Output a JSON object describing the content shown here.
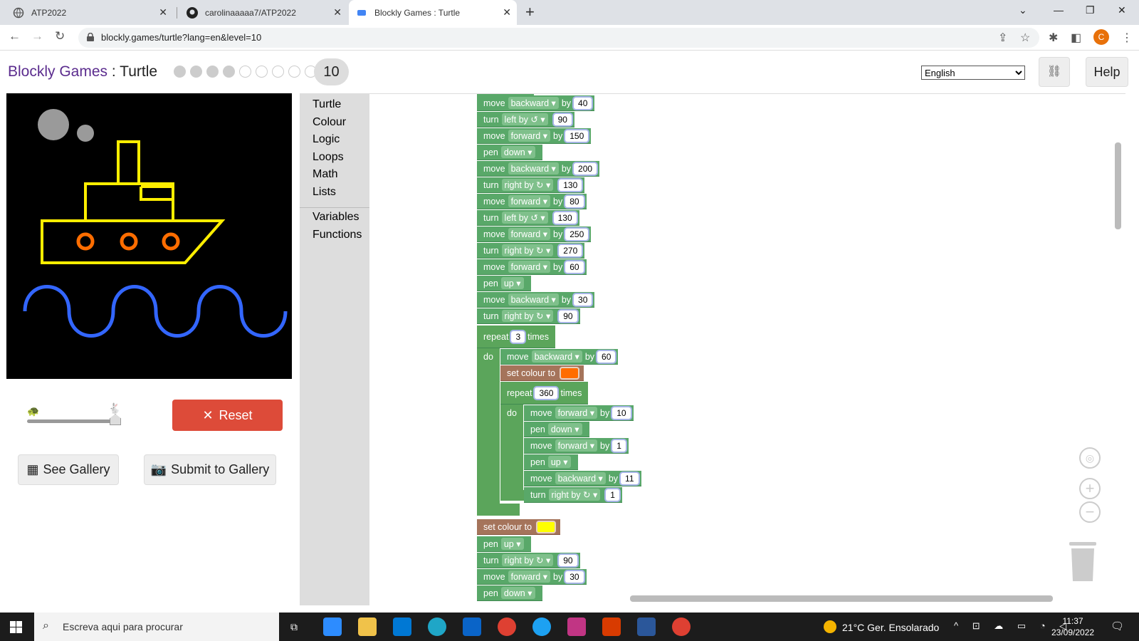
{
  "browser": {
    "tabs": [
      {
        "title": "ATP2022"
      },
      {
        "title": "carolinaaaaa7/ATP2022"
      },
      {
        "title": "Blockly Games : Turtle"
      }
    ],
    "url": "blockly.games/turtle?lang=en&level=10",
    "profile_initial": "C"
  },
  "header": {
    "site_name": "Blockly Games",
    "separator": " : ",
    "game_name": "Turtle",
    "level": "10",
    "levels_completed": 4,
    "levels_total": 9,
    "language": "English",
    "help_label": "Help"
  },
  "controls": {
    "reset_label": "Reset",
    "see_gallery_label": "See Gallery",
    "submit_gallery_label": "Submit to Gallery"
  },
  "toolbox": {
    "categories": [
      "Turtle",
      "Colour",
      "Logic",
      "Loops",
      "Math",
      "Lists"
    ],
    "extra": [
      "Variables",
      "Functions"
    ]
  },
  "blocks": {
    "b1": {
      "kw": "move",
      "dir": "backward",
      "by": "by",
      "val": "40"
    },
    "b2": {
      "kw": "turn",
      "dir": "left by ↺",
      "val": "90"
    },
    "b3": {
      "kw": "move",
      "dir": "forward",
      "by": "by",
      "val": "150"
    },
    "b4": {
      "kw": "pen",
      "dir": "down"
    },
    "b5": {
      "kw": "move",
      "dir": "backward",
      "by": "by",
      "val": "200"
    },
    "b6": {
      "kw": "turn",
      "dir": "right by ↻",
      "val": "130"
    },
    "b7": {
      "kw": "move",
      "dir": "forward",
      "by": "by",
      "val": "80"
    },
    "b8": {
      "kw": "turn",
      "dir": "left by ↺",
      "val": "130"
    },
    "b9": {
      "kw": "move",
      "dir": "forward",
      "by": "by",
      "val": "250"
    },
    "b10": {
      "kw": "turn",
      "dir": "right by ↻",
      "val": "270"
    },
    "b11": {
      "kw": "move",
      "dir": "forward",
      "by": "by",
      "val": "60"
    },
    "b12": {
      "kw": "pen",
      "dir": "up"
    },
    "b13": {
      "kw": "move",
      "dir": "backward",
      "by": "by",
      "val": "30"
    },
    "b14": {
      "kw": "turn",
      "dir": "right by ↻",
      "val": "90"
    },
    "r1": {
      "kw": "repeat",
      "val": "3",
      "times": "times",
      "do": "do"
    },
    "b15": {
      "kw": "move",
      "dir": "backward",
      "by": "by",
      "val": "60"
    },
    "c1": {
      "kw": "set colour to",
      "color": "#ff6d00"
    },
    "r2": {
      "kw": "repeat",
      "val": "360",
      "times": "times",
      "do": "do"
    },
    "b16": {
      "kw": "move",
      "dir": "forward",
      "by": "by",
      "val": "10"
    },
    "b17": {
      "kw": "pen",
      "dir": "down"
    },
    "b18": {
      "kw": "move",
      "dir": "forward",
      "by": "by",
      "val": "1"
    },
    "b19": {
      "kw": "pen",
      "dir": "up"
    },
    "b20": {
      "kw": "move",
      "dir": "backward",
      "by": "by",
      "val": "11"
    },
    "b21": {
      "kw": "turn",
      "dir": "right by ↻",
      "val": "1"
    },
    "c2": {
      "kw": "set colour to",
      "color": "#ffff00"
    },
    "b22": {
      "kw": "pen",
      "dir": "up"
    },
    "b23": {
      "kw": "turn",
      "dir": "right by ↻",
      "val": "90"
    },
    "b24": {
      "kw": "move",
      "dir": "forward",
      "by": "by",
      "val": "30"
    },
    "b25": {
      "kw": "pen",
      "dir": "down"
    }
  },
  "taskbar": {
    "search_placeholder": "Escreva aqui para procurar",
    "weather": "21°C  Ger. Ensolarado",
    "time": "11:37",
    "date": "23/09/2022"
  },
  "colors": {
    "accent_title": "#5b2c8e",
    "reset": "#dd4b39",
    "turtle_block": "#59a869",
    "colour_block": "#a5745b"
  }
}
